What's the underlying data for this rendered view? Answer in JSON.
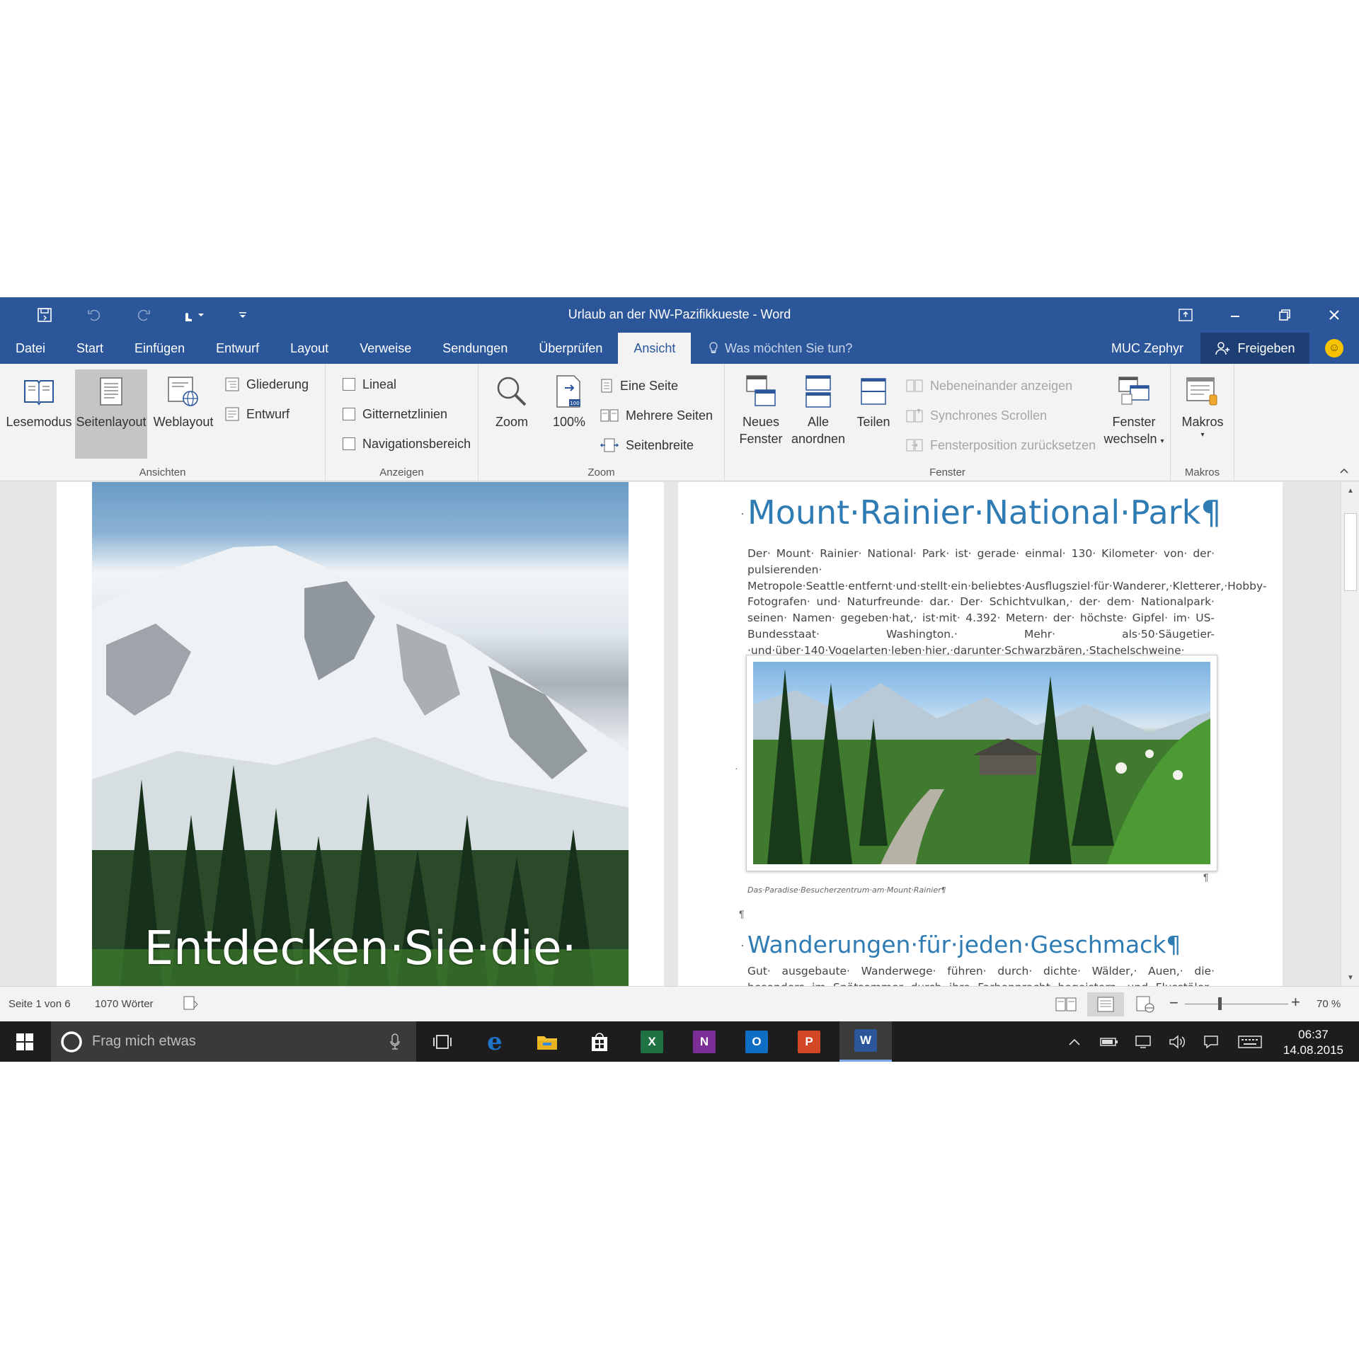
{
  "window": {
    "title": "Urlaub an der NW-Pazifikkueste - Word",
    "accent_color": "#2b579a"
  },
  "qat": {
    "icons": [
      "save-icon",
      "undo-icon",
      "redo-icon",
      "touch-mode-icon",
      "customize-qat-icon"
    ]
  },
  "tabs": [
    "Datei",
    "Start",
    "Einfügen",
    "Entwurf",
    "Layout",
    "Verweise",
    "Sendungen",
    "Überprüfen",
    "Ansicht"
  ],
  "active_tab": "Ansicht",
  "tell_me": {
    "placeholder": "Was möchten Sie tun?"
  },
  "user": {
    "name": "MUC Zephyr"
  },
  "share": {
    "label": "Freigeben"
  },
  "ribbon": {
    "ansichten": {
      "label": "Ansichten",
      "lesemodus": "Lesemodus",
      "seitenlayout": "Seitenlayout",
      "weblayout": "Weblayout",
      "gliederung": "Gliederung",
      "entwurf": "Entwurf"
    },
    "anzeigen": {
      "label": "Anzeigen",
      "lineal": "Lineal",
      "gitternetzlinien": "Gitternetzlinien",
      "navigationsbereich": "Navigationsbereich"
    },
    "zoom": {
      "label": "Zoom",
      "zoom": "Zoom",
      "hundert": "100%",
      "eine_seite": "Eine Seite",
      "mehrere_seiten": "Mehrere Seiten",
      "seitenbreite": "Seitenbreite"
    },
    "fenster": {
      "label": "Fenster",
      "neues": "Neues",
      "fenster": "Fenster",
      "alle": "Alle",
      "anordnen": "anordnen",
      "teilen": "Teilen",
      "nebeneinander": "Nebeneinander anzeigen",
      "synchron": "Synchrones Scrollen",
      "position": "Fensterposition zurücksetzen",
      "wechseln_1": "Fenster",
      "wechseln_2": "wechseln"
    },
    "makros": {
      "label": "Makros",
      "makros": "Makros"
    }
  },
  "document": {
    "cover_text": "Entdecken·Sie·die·",
    "heading1": "Mount·Rainier·National·Park¶",
    "paragraph1": "Der· Mount· Rainier· National· Park· ist· gerade· einmal· 130· Kilometer· von· der· pulsierenden· Metropole·Seattle·entfernt·und·stellt·ein·beliebtes·Ausflugsziel·für·Wanderer,·Kletterer,·Hobby-Fotografen· und· Naturfreunde· dar.· Der· Schichtvulkan,· der· dem· Nationalpark· seinen· Namen· gegeben·hat,· ist·mit· 4.392· Metern· der· höchste· Gipfel· im· US-Bundesstaat· Washington.· Mehr· als·50·Säugetier-·und·über·140·Vogelarten·leben·hier,·darunter·Schwarzbären,·Stachelschweine· und·Pumas·sowie·Steinadler,·Habichte·und·Kolibris.¶",
    "caption": "Das·Paradise·Besucherzentrum·am·Mount·Rainier¶",
    "pilcrow": "¶",
    "heading2": "Wanderungen·für·jeden·Geschmack¶",
    "paragraph2": "Gut· ausgebaute· Wanderwege· führen· durch· dichte· Wälder,· Auen,· die· besonders· im· Spätsommer· durch· ihre· Farbenpracht· begeistern,· und· Flusstäler.· Die· beiden· mit· Abstand·"
  },
  "status": {
    "page": "Seite 1 von 6",
    "words": "1070 Wörter",
    "zoom": "70 %",
    "zoom_percent": 70
  },
  "taskbar": {
    "search_placeholder": "Frag mich etwas",
    "apps": [
      {
        "name": "task-view",
        "label": ""
      },
      {
        "name": "edge",
        "label": "e",
        "color": "#1e73c8"
      },
      {
        "name": "file-explorer",
        "label": "",
        "color": "#f2c230"
      },
      {
        "name": "store",
        "label": "",
        "color": "#ffffff"
      },
      {
        "name": "excel",
        "label": "X",
        "color": "#1f7244"
      },
      {
        "name": "onenote",
        "label": "N",
        "color": "#7b2f96"
      },
      {
        "name": "outlook",
        "label": "O",
        "color": "#0f6dc3"
      },
      {
        "name": "powerpoint",
        "label": "P",
        "color": "#d24726"
      },
      {
        "name": "word",
        "label": "W",
        "color": "#2b579a"
      }
    ],
    "time": "06:37",
    "date": "14.08.2015"
  }
}
